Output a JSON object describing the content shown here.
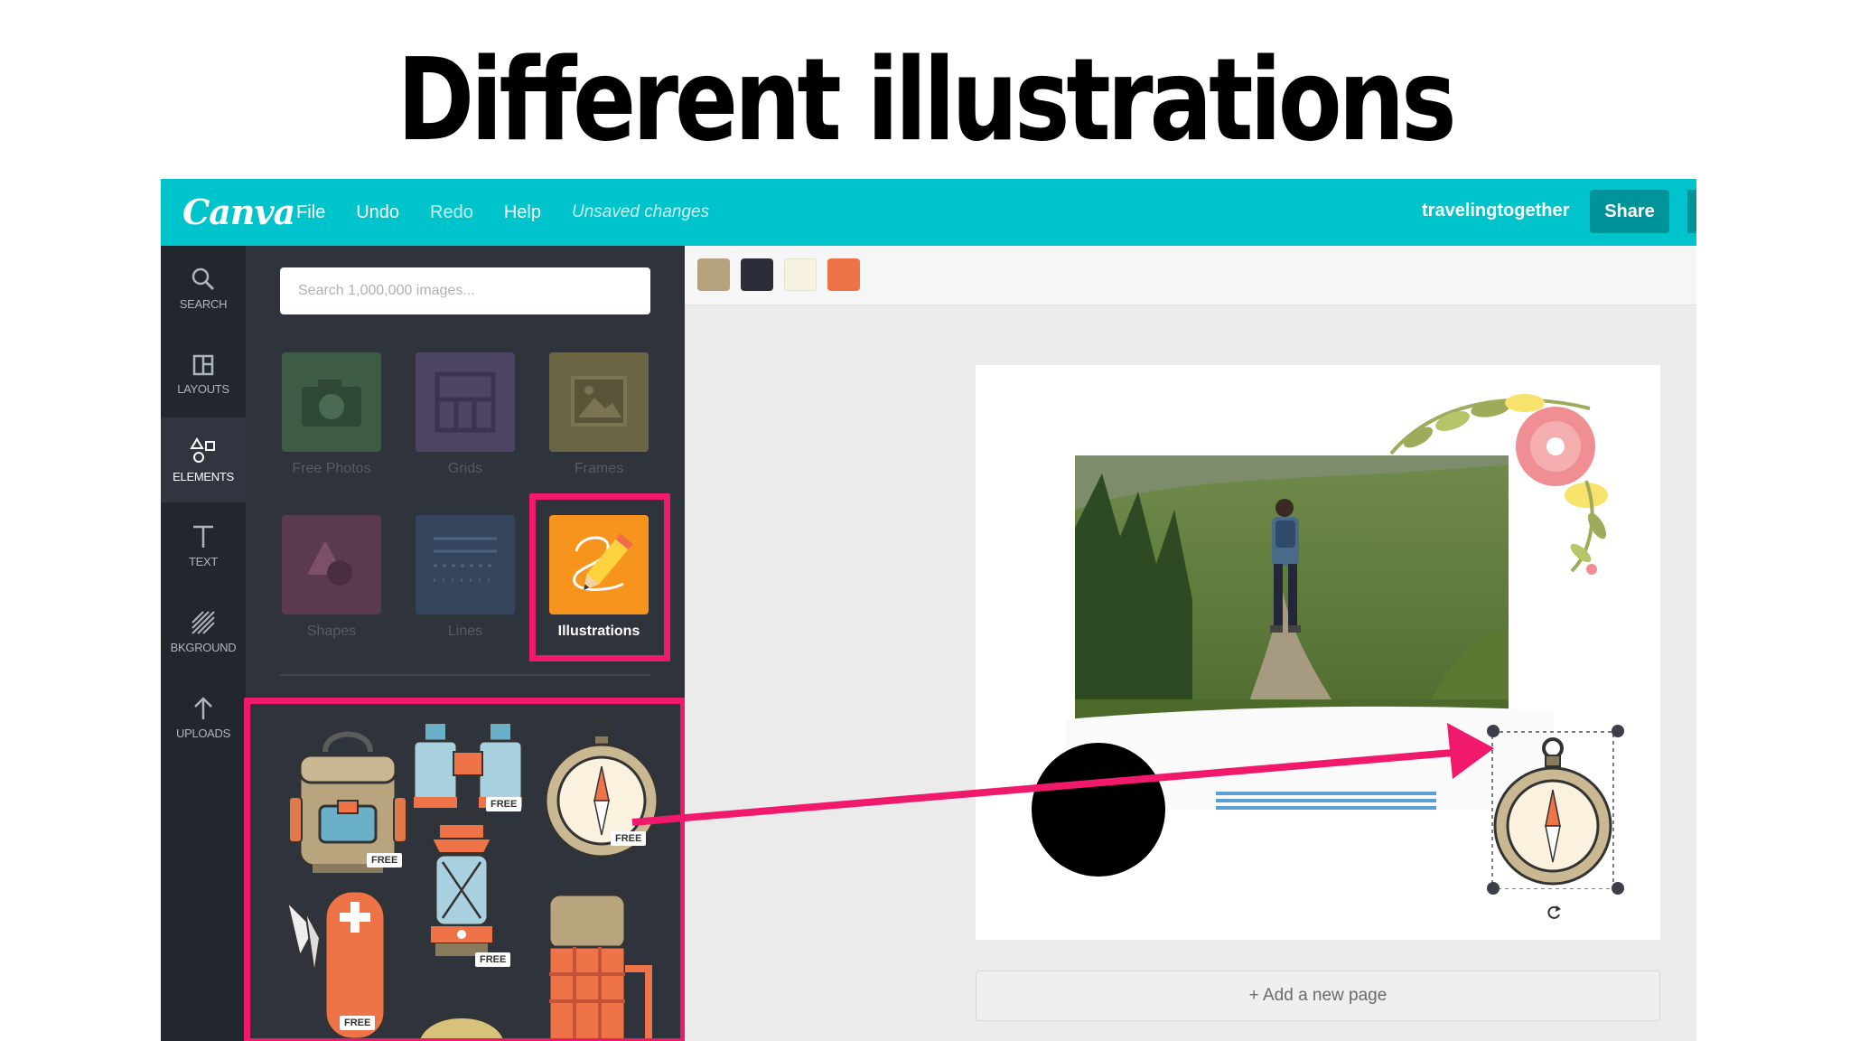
{
  "slide": {
    "title": "Different illustrations"
  },
  "topbar": {
    "logo": "Canva",
    "menu": [
      {
        "label": "File"
      },
      {
        "label": "Undo"
      },
      {
        "label": "Redo"
      },
      {
        "label": "Help"
      }
    ],
    "status": "Unsaved changes",
    "account": "travelingtogether",
    "share_label": "Share"
  },
  "rail": [
    {
      "label": "SEARCH",
      "icon": "search-icon"
    },
    {
      "label": "LAYOUTS",
      "icon": "layouts-icon"
    },
    {
      "label": "ELEMENTS",
      "icon": "elements-icon",
      "active": true
    },
    {
      "label": "TEXT",
      "icon": "text-icon"
    },
    {
      "label": "BKGROUND",
      "icon": "background-icon"
    },
    {
      "label": "UPLOADS",
      "icon": "upload-icon"
    }
  ],
  "panel": {
    "search_placeholder": "Search 1,000,000 images...",
    "tiles": [
      {
        "label": "Free Photos",
        "icon": "camera-icon",
        "color": "#3e5b46"
      },
      {
        "label": "Grids",
        "icon": "grid-icon",
        "color": "#4e4565"
      },
      {
        "label": "Frames",
        "icon": "frame-icon",
        "color": "#6a6544"
      },
      {
        "label": "Shapes",
        "icon": "shapes-icon",
        "color": "#5c3a4e"
      },
      {
        "label": "Lines",
        "icon": "lines-icon",
        "color": "#34455d"
      },
      {
        "label": "Illustrations",
        "icon": "pencil-icon",
        "color": "#f7941d",
        "selected": true
      }
    ],
    "illustrations": [
      {
        "name": "backpack",
        "badge": "FREE"
      },
      {
        "name": "binoculars",
        "badge": "FREE"
      },
      {
        "name": "compass",
        "badge": "FREE"
      },
      {
        "name": "pocket-knife",
        "badge": "FREE"
      },
      {
        "name": "lantern",
        "badge": "FREE"
      },
      {
        "name": "thermos",
        "badge": ""
      }
    ]
  },
  "palette": [
    "#b5a37e",
    "#2b2d38",
    "#f7f1e1",
    "#ee7448"
  ],
  "canvas": {
    "add_page_label": "+ Add a new page"
  },
  "colors": {
    "accent": "#00c4cc",
    "highlight": "#f0196c"
  }
}
